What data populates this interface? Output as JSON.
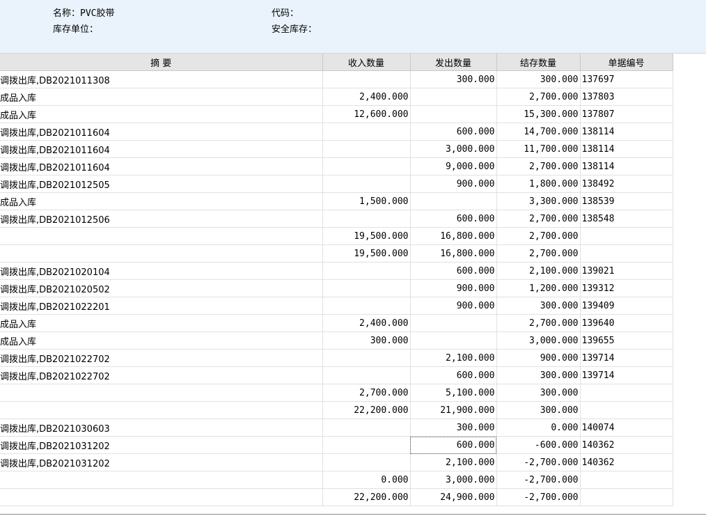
{
  "header": {
    "cut_title": "",
    "name_label": "名称：",
    "name_value": "PVC胶带",
    "code_label": "代码：",
    "code_value": "",
    "unit_label": "库存单位：",
    "unit_value": "",
    "safety_label": "安全库存：",
    "safety_value": ""
  },
  "columns": {
    "summary": "摘    要",
    "in_qty": "收入数量",
    "out_qty": "发出数量",
    "balance_qty": "结存数量",
    "doc_no": "单据编号"
  },
  "rows": [
    {
      "summary": "调拨出库,DB2021011308",
      "in": "",
      "out": "300.000",
      "bal": "300.000",
      "doc": "137697"
    },
    {
      "summary": "成品入库",
      "in": "2,400.000",
      "out": "",
      "bal": "2,700.000",
      "doc": "137803"
    },
    {
      "summary": "成品入库",
      "in": "12,600.000",
      "out": "",
      "bal": "15,300.000",
      "doc": "137807"
    },
    {
      "summary": "调拨出库,DB2021011604",
      "in": "",
      "out": "600.000",
      "bal": "14,700.000",
      "doc": "138114"
    },
    {
      "summary": "调拨出库,DB2021011604",
      "in": "",
      "out": "3,000.000",
      "bal": "11,700.000",
      "doc": "138114"
    },
    {
      "summary": "调拨出库,DB2021011604",
      "in": "",
      "out": "9,000.000",
      "bal": "2,700.000",
      "doc": "138114"
    },
    {
      "summary": "调拨出库,DB2021012505",
      "in": "",
      "out": "900.000",
      "bal": "1,800.000",
      "doc": "138492"
    },
    {
      "summary": "成品入库",
      "in": "1,500.000",
      "out": "",
      "bal": "3,300.000",
      "doc": "138539"
    },
    {
      "summary": "调拨出库,DB2021012506",
      "in": "",
      "out": "600.000",
      "bal": "2,700.000",
      "doc": "138548"
    },
    {
      "summary": "",
      "in": "19,500.000",
      "out": "16,800.000",
      "bal": "2,700.000",
      "doc": ""
    },
    {
      "summary": "",
      "in": "19,500.000",
      "out": "16,800.000",
      "bal": "2,700.000",
      "doc": ""
    },
    {
      "summary": "调拨出库,DB2021020104",
      "in": "",
      "out": "600.000",
      "bal": "2,100.000",
      "doc": "139021"
    },
    {
      "summary": "调拨出库,DB2021020502",
      "in": "",
      "out": "900.000",
      "bal": "1,200.000",
      "doc": "139312"
    },
    {
      "summary": "调拨出库,DB2021022201",
      "in": "",
      "out": "900.000",
      "bal": "300.000",
      "doc": "139409"
    },
    {
      "summary": "成品入库",
      "in": "2,400.000",
      "out": "",
      "bal": "2,700.000",
      "doc": "139640"
    },
    {
      "summary": "成品入库",
      "in": "300.000",
      "out": "",
      "bal": "3,000.000",
      "doc": "139655"
    },
    {
      "summary": "调拨出库,DB2021022702",
      "in": "",
      "out": "2,100.000",
      "bal": "900.000",
      "doc": "139714"
    },
    {
      "summary": "调拨出库,DB2021022702",
      "in": "",
      "out": "600.000",
      "bal": "300.000",
      "doc": "139714"
    },
    {
      "summary": "",
      "in": "2,700.000",
      "out": "5,100.000",
      "bal": "300.000",
      "doc": ""
    },
    {
      "summary": "",
      "in": "22,200.000",
      "out": "21,900.000",
      "bal": "300.000",
      "doc": ""
    },
    {
      "summary": "调拨出库,DB2021030603",
      "in": "",
      "out": "300.000",
      "bal": "0.000",
      "doc": "140074"
    },
    {
      "summary": "调拨出库,DB2021031202",
      "in": "",
      "out": "600.000",
      "bal": "-600.000",
      "doc": "140362"
    },
    {
      "summary": "调拨出库,DB2021031202",
      "in": "",
      "out": "2,100.000",
      "bal": "-2,700.000",
      "doc": "140362"
    },
    {
      "summary": "",
      "in": "0.000",
      "out": "3,000.000",
      "bal": "-2,700.000",
      "doc": ""
    },
    {
      "summary": "",
      "in": "22,200.000",
      "out": "24,900.000",
      "bal": "-2,700.000",
      "doc": ""
    }
  ],
  "focused_cell": {
    "row": 21,
    "column": "out"
  }
}
